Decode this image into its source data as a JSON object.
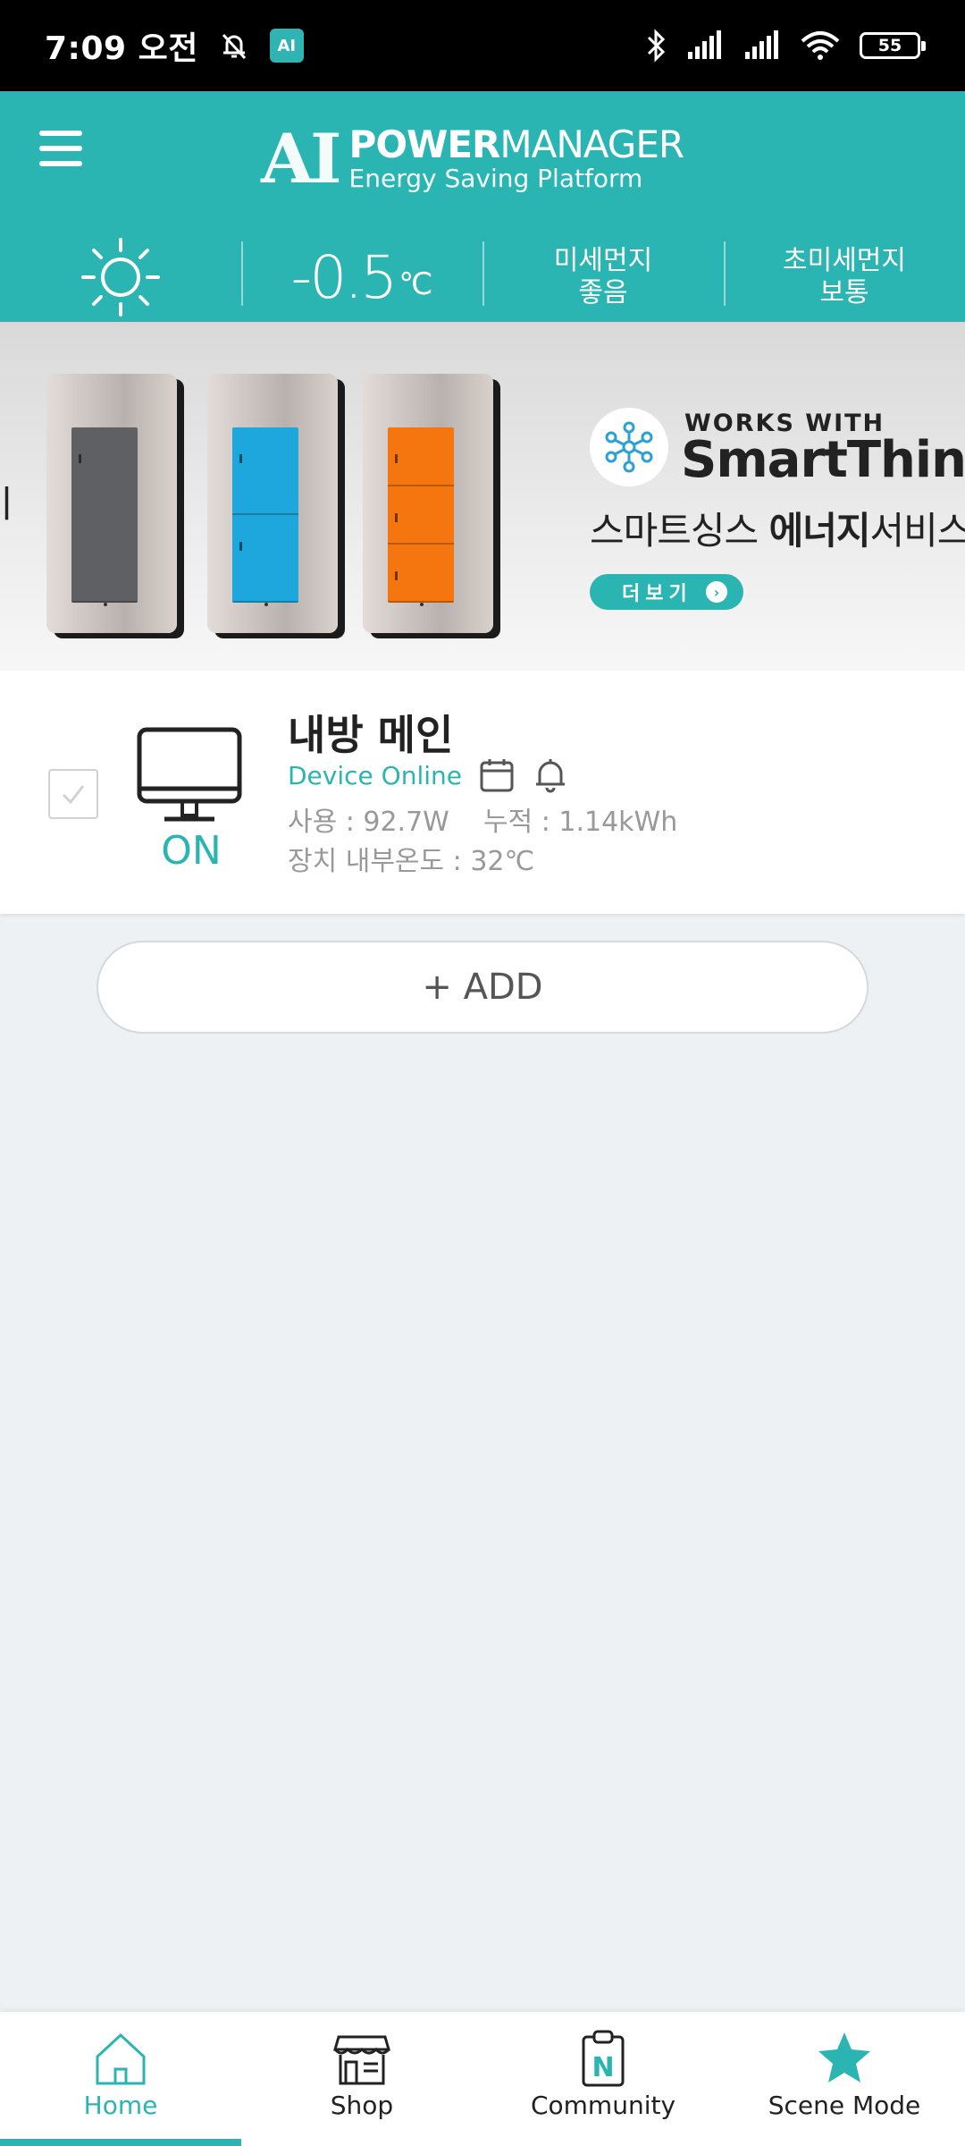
{
  "status_bar": {
    "time": "7:09 오전",
    "app_badge": "AI",
    "battery": "55"
  },
  "header": {
    "logo_mark": "AI",
    "title_bold": "POWER",
    "title_light": "MANAGER",
    "subtitle": "Energy Saving Platform",
    "weather": {
      "icon": "sun-icon",
      "temperature": "-0.5",
      "temperature_unit": "℃",
      "fine_dust_label": "미세먼지",
      "fine_dust_value": "좋음",
      "ultrafine_dust_label": "초미세먼지",
      "ultrafine_dust_value": "보통"
    }
  },
  "banner": {
    "edge_char": "ㅣ",
    "works_with": "WORKS WITH",
    "brand": "SmartThings",
    "service_prefix": "스마트싱스 ",
    "service_bold": "에너지",
    "service_suffix": "서비스",
    "more_label": "더보기",
    "switch_colors": [
      "#5f6063",
      "#1ea7dc",
      "#f5760f"
    ]
  },
  "device": {
    "name": "내방 메인",
    "state": "ON",
    "status": "Device Online",
    "usage": "사용 : 92.7W    누적 : 1.14kWh",
    "internal_temp": "장치 내부온도 : 32℃"
  },
  "add_button": {
    "label": "+ ADD"
  },
  "bottom_nav": {
    "items": [
      {
        "label": "Home",
        "icon": "home-icon",
        "active": true
      },
      {
        "label": "Shop",
        "icon": "shop-icon",
        "active": false
      },
      {
        "label": "Community",
        "icon": "community-icon",
        "active": false
      },
      {
        "label": "Scene Mode",
        "icon": "star-icon",
        "active": false
      }
    ]
  },
  "colors": {
    "accent": "#2bb5b2",
    "status_bar": "#000000",
    "background": "#eef1f4"
  }
}
